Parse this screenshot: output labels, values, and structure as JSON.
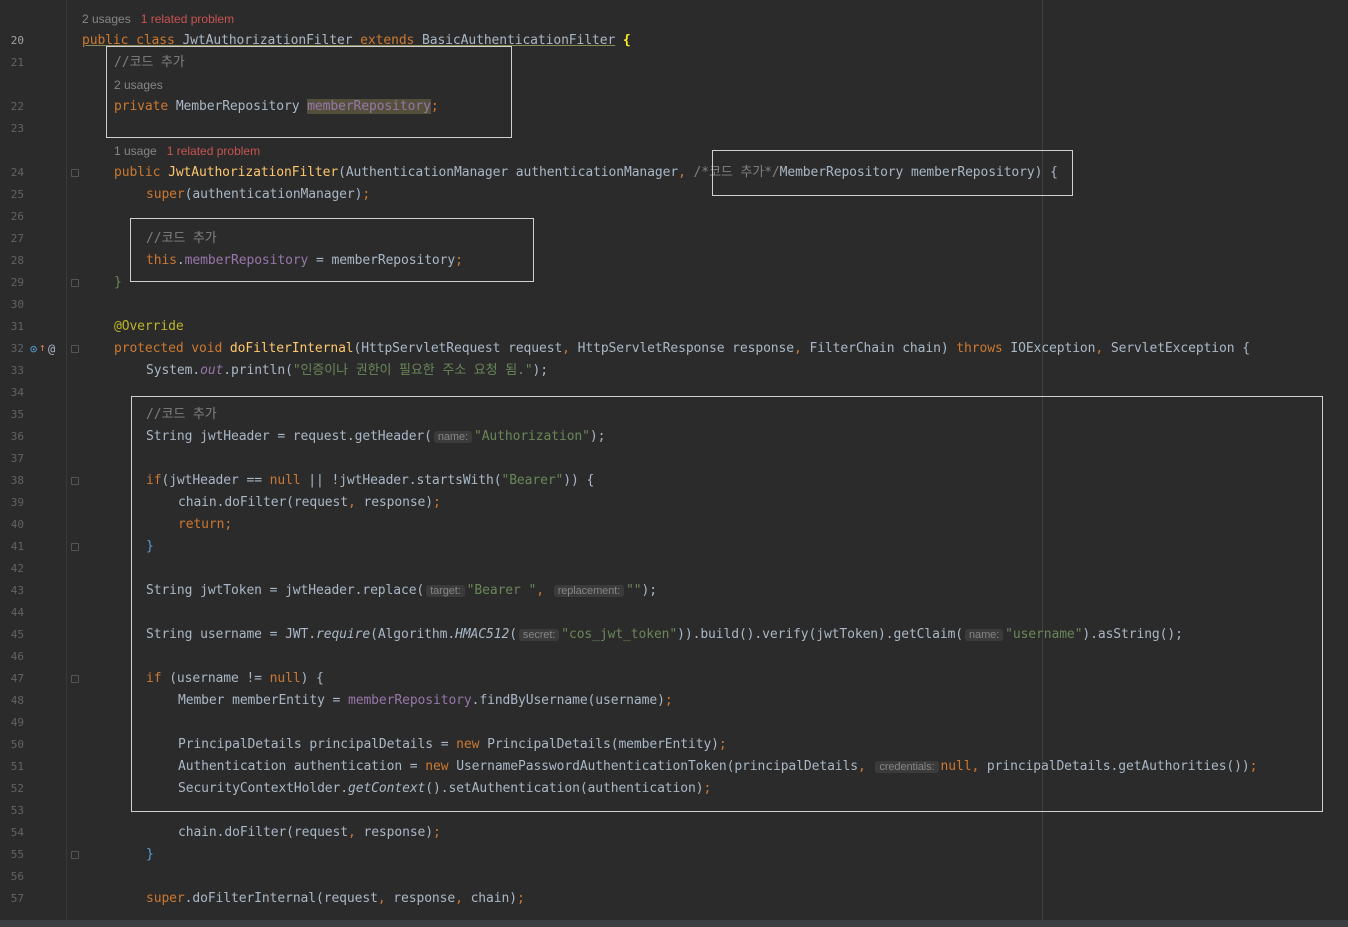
{
  "gutter": {
    "line_numbers": [
      "20",
      "21",
      "22",
      "23",
      "24",
      "25",
      "26",
      "27",
      "28",
      "29",
      "30",
      "31",
      "32",
      "33",
      "34",
      "35",
      "36",
      "37",
      "38",
      "39",
      "40",
      "41",
      "42",
      "43",
      "44",
      "45",
      "46",
      "47",
      "48",
      "49",
      "50",
      "51",
      "52",
      "53",
      "54",
      "55",
      "56",
      "57"
    ],
    "override_icon": "override-implement-icon",
    "annotation_icon": "at-sign-icon"
  },
  "meta": {
    "class_usages": "2 usages",
    "class_problem": "1 related problem",
    "field_usages": "2 usages",
    "ctor_usages": "1 usage",
    "ctor_problem": "1 related problem"
  },
  "code": {
    "l20_a": "public class ",
    "l20_b": "JwtAuthorizationFilter",
    "l20_c": " extends ",
    "l20_d": "BasicAuthenticationFilter",
    "l20_e": " {",
    "l21": "//코드 추가",
    "l22_a": "private ",
    "l22_b": "MemberRepository ",
    "l22_c": "memberRepository",
    "l22_d": ";",
    "l24_a": "public ",
    "l24_b": "JwtAuthorizationFilter",
    "l24_c": "(AuthenticationManager authenticationManager",
    "l24_d": ", ",
    "l24_e": "/*코드 추가*/",
    "l24_f": "MemberRepository memberRepository",
    "l24_g": ") {",
    "l25_a": "super",
    "l25_b": "(authenticationManager)",
    "l25_c": ";",
    "l27": "//코드 추가",
    "l28_a": "this",
    "l28_b": ".",
    "l28_c": "memberRepository",
    "l28_d": " = memberRepository",
    "l28_e": ";",
    "l29": "}",
    "l31": "@Override",
    "l32_a": "protected void ",
    "l32_b": "doFilterInternal",
    "l32_c": "(HttpServletRequest request",
    "l32_d": ", ",
    "l32_e": "HttpServletResponse response",
    "l32_f": ", ",
    "l32_g": "FilterChain chain) ",
    "l32_h": "throws ",
    "l32_i": "IOException",
    "l32_j": ", ",
    "l32_k": "ServletException {",
    "l33_a": "System.",
    "l33_b": "out",
    "l33_c": ".println(",
    "l33_d": "\"인증이나 권한이 필요한 주소 요청 됨.\"",
    "l33_e": ");",
    "l35": "//코드 추가",
    "l36_a": "String jwtHeader = request.getHeader(",
    "l36_hint": "name:",
    "l36_b": "\"Authorization\"",
    "l36_c": ");",
    "l38_a": "if",
    "l38_b": "(jwtHeader == ",
    "l38_c": "null ",
    "l38_d": "|| !jwtHeader.startsWith(",
    "l38_e": "\"Bearer\"",
    "l38_f": ")) {",
    "l39_a": "chain.doFilter(request",
    "l39_b": ", ",
    "l39_c": "response)",
    "l39_d": ";",
    "l40": "return;",
    "l41": "}",
    "l43_a": "String jwtToken = jwtHeader.replace(",
    "l43_hint1": "target:",
    "l43_b": "\"Bearer \"",
    "l43_c": ", ",
    "l43_hint2": "replacement:",
    "l43_d": "\"\"",
    "l43_e": ");",
    "l45_a": "String username = JWT.",
    "l45_b": "require",
    "l45_c": "(Algorithm.",
    "l45_d": "HMAC512",
    "l45_e": "(",
    "l45_hint": "secret:",
    "l45_f": "\"cos_jwt_token\"",
    "l45_g": ")).build().verify(jwtToken).getClaim(",
    "l45_hint2": "name:",
    "l45_h": "\"username\"",
    "l45_i": ").asString();",
    "l47_a": "if ",
    "l47_b": "(username != ",
    "l47_c": "null",
    "l47_d": ") {",
    "l48_a": "Member memberEntity = ",
    "l48_b": "memberRepository",
    "l48_c": ".findByUsername(username)",
    "l48_d": ";",
    "l50_a": "PrincipalDetails principalDetails = ",
    "l50_b": "new ",
    "l50_c": "PrincipalDetails(memberEntity)",
    "l50_d": ";",
    "l51_a": "Authentication authentication = ",
    "l51_b": "new ",
    "l51_c": "UsernamePasswordAuthenticationToken(principalDetails",
    "l51_d": ", ",
    "l51_hint": "credentials:",
    "l51_e": "null",
    "l51_f": ", ",
    "l51_g": "principalDetails.getAuthorities())",
    "l51_h": ";",
    "l52_a": "SecurityContextHolder.",
    "l52_b": "getContext",
    "l52_c": "().setAuthentication(authentication)",
    "l52_d": ";",
    "l54_a": "chain.doFilter(request",
    "l54_b": ", ",
    "l54_c": "response)",
    "l54_d": ";",
    "l55": "}",
    "l57_a": "super",
    "l57_b": ".doFilterInternal(request",
    "l57_c": ", ",
    "l57_d": "response",
    "l57_e": ", ",
    "l57_f": "chain)",
    "l57_g": ";"
  },
  "colors": {
    "background": "#2b2b2b",
    "keyword": "#cc7832",
    "string": "#6a8759",
    "field": "#9876aa",
    "method": "#ffc66d",
    "annotation": "#bbb529",
    "comment": "#808080"
  }
}
